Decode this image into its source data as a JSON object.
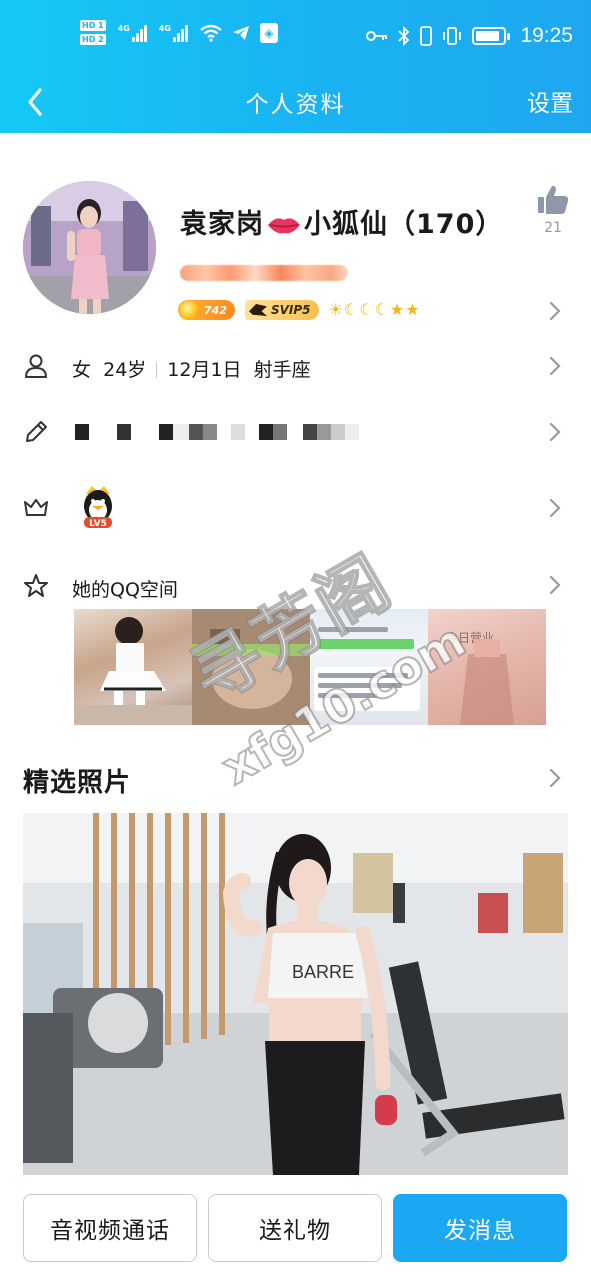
{
  "status_bar": {
    "hd1": "HD 1",
    "hd2": "HD 2",
    "sig1_label": "4G",
    "sig2_label": "4G",
    "time": "19:25",
    "battery_percent": 85
  },
  "nav": {
    "back_icon": "chevron-left-icon",
    "title": "个人资料",
    "settings_label": "设置"
  },
  "profile": {
    "name_part1": "袁家岗",
    "name_part2": "小狐仙（170）",
    "like_count": "21",
    "coin_value": "742",
    "svip_label": "SVIP5"
  },
  "info": {
    "gender": "女",
    "age": "24岁",
    "birthday": "12月1日",
    "zodiac": "射手座",
    "qq_level_label": "LV5",
    "zone_label": "她的QQ空间",
    "zone_photo_caption": "今日营业"
  },
  "watermark": {
    "cn": "寻芳阁",
    "en": "xfg10.com"
  },
  "featured": {
    "title": "精选照片",
    "shirt_text": "BARRE"
  },
  "actions": {
    "call_label": "音视频通话",
    "gift_label": "送礼物",
    "message_label": "发消息"
  },
  "colors": {
    "brand": "#19b4f2",
    "primary_button": "#1aa8f2"
  }
}
